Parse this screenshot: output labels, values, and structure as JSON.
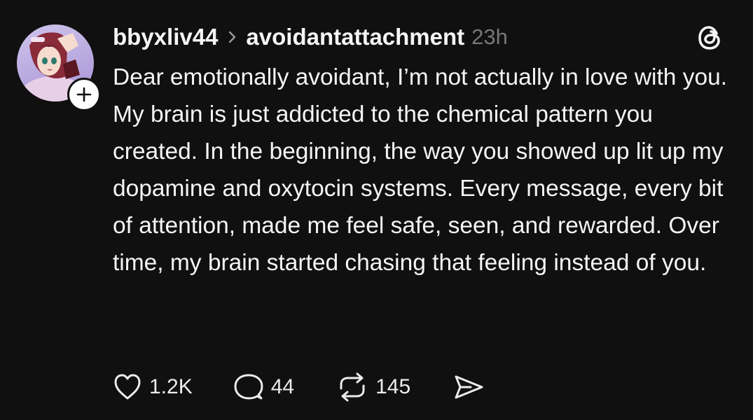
{
  "post": {
    "username": "bbyxliv44",
    "community": "avoidantattachment",
    "timestamp": "23h",
    "text": "Dear emotionally avoidant, I’m not actually in love with you. My brain is just addicted to the chemical pattern you created. In the beginning, the way you showed up lit up my dopamine and oxytocin systems. Every message, every bit of attention, made me feel safe, seen, and rewarded. Over time, my brain started chasing that feeling instead of you."
  },
  "actions": {
    "like_count": "1.2K",
    "reply_count": "44",
    "repost_count": "145"
  },
  "icons": {
    "header_separator": "chevron-right-icon",
    "brand": "threads-logo-icon",
    "follow": "plus-icon",
    "like": "heart-icon",
    "reply": "comment-bubble-icon",
    "repost": "repost-icon",
    "share": "send-icon"
  },
  "colors": {
    "background": "#101010",
    "text": "#f3f5f7",
    "timestamp": "#777777"
  }
}
